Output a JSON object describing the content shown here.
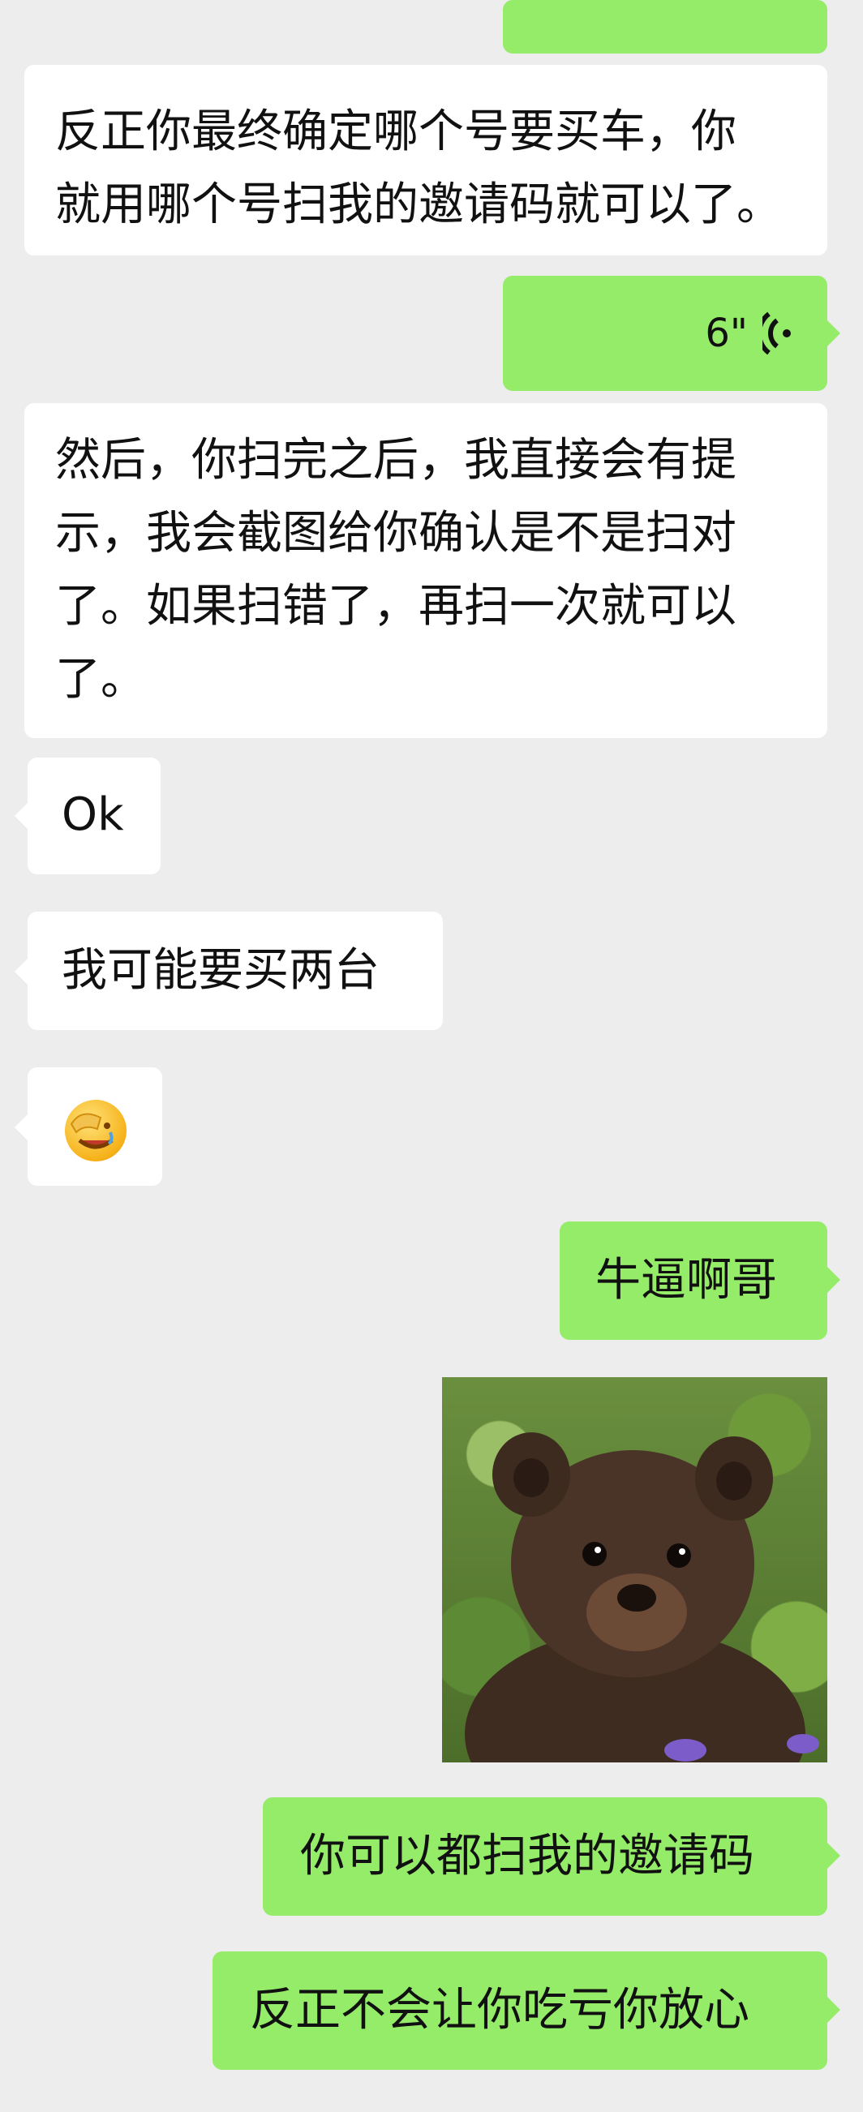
{
  "chat": {
    "messages": [
      {
        "id": "m1",
        "side": "in",
        "type": "text",
        "text": "反正你最终确定哪个号要买车，你\n就用哪个号扫我的邀请码就可以了。"
      },
      {
        "id": "m2",
        "side": "out",
        "type": "voice",
        "duration": "6\""
      },
      {
        "id": "m3",
        "side": "in",
        "type": "text",
        "text": "然后，你扫完之后，我直接会有提\n示，我会截图给你确认是不是扫对\n了。如果扫错了，再扫一次就可以\n了。"
      },
      {
        "id": "m4",
        "side": "in",
        "type": "text",
        "text": "Ok"
      },
      {
        "id": "m5",
        "side": "in",
        "type": "text",
        "text": "我可能要买两台"
      },
      {
        "id": "m6",
        "side": "in",
        "type": "emoji",
        "emoji": "facepalm-emoji"
      },
      {
        "id": "m7",
        "side": "out",
        "type": "text",
        "text": "牛逼啊哥"
      },
      {
        "id": "m8",
        "side": "out",
        "type": "image",
        "image": "brown-bear-cub-photo"
      },
      {
        "id": "m9",
        "side": "out",
        "type": "text",
        "text": "你可以都扫我的邀请码"
      },
      {
        "id": "m10",
        "side": "out",
        "type": "text",
        "text": "反正不会让你吃亏你放心"
      }
    ]
  },
  "colors": {
    "background": "#ededed",
    "incoming_bubble": "#ffffff",
    "outgoing_bubble": "#95ec69"
  }
}
